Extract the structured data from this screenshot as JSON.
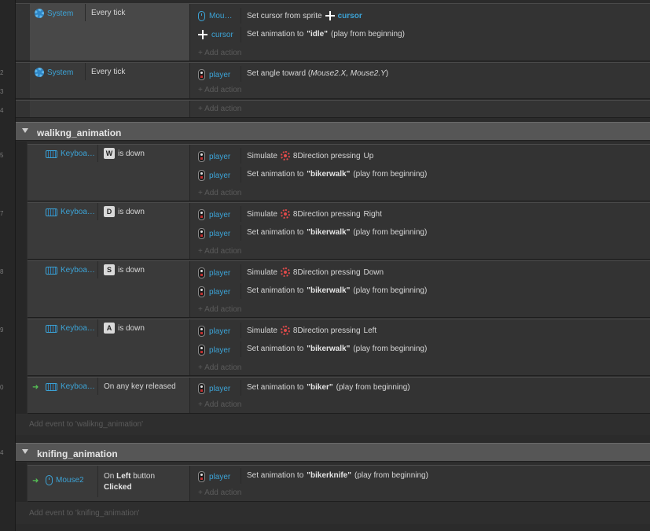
{
  "common": {
    "add_action": "+ Add action",
    "is_down": "is down",
    "simulate": "Simulate",
    "eight_dir": "8Direction pressing",
    "set_anim": "Set animation to",
    "play_begin": "(play from beginning)",
    "player": "player",
    "keyboard": "Keyboa…",
    "system": "System",
    "every_tick": "Every tick"
  },
  "gutter": {
    "numbers": [
      "2",
      "3",
      "4",
      "5",
      "6",
      "7",
      "8",
      "9",
      "0"
    ]
  },
  "event1": {
    "cond_obj": "System",
    "cond_text": "Every tick",
    "actions": [
      {
        "obj": "Mou…",
        "text": "Set cursor from sprite",
        "target": "cursor"
      },
      {
        "obj": "cursor",
        "text": "Set animation to",
        "anim": "\"idle\"",
        "tail": "(play from beginning)"
      }
    ]
  },
  "event2": {
    "cond_obj": "System",
    "cond_text": "Every tick",
    "action": {
      "obj": "player",
      "text": "Set angle toward (",
      "args": "Mouse2.X, Mouse2.Y",
      "close": ")"
    }
  },
  "group1": {
    "title": "walikng_animation",
    "add_event": "Add event to 'walikng_animation'",
    "events": [
      {
        "key": "W",
        "dir": "Up"
      },
      {
        "key": "D",
        "dir": "Right"
      },
      {
        "key": "S",
        "dir": "Down"
      },
      {
        "key": "A",
        "dir": "Left"
      }
    ],
    "anim": "\"bikerwalk\"",
    "release": {
      "cond_text": "On any key released",
      "anim": "\"biker\""
    }
  },
  "group2": {
    "title": "knifing_animation",
    "add_event": "Add event to 'knifing_animation'",
    "cond_obj": "Mouse2",
    "cond_pre": "On",
    "cond_btn": "Left",
    "cond_post": "button",
    "cond_line2": "Clicked",
    "anim": "\"bikerknife\""
  },
  "colors": {
    "accent": "#3ca3d6",
    "trigger": "#55c155",
    "background": "#2b2b2b",
    "group_header": "#565656"
  }
}
